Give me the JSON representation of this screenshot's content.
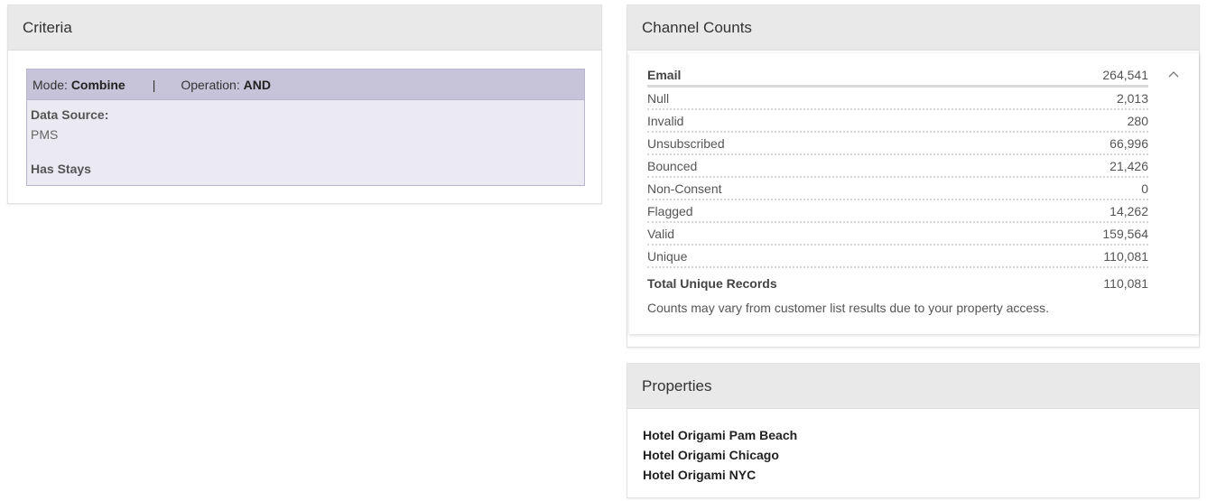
{
  "criteria": {
    "title": "Criteria",
    "mode_label": "Mode:",
    "mode_value": "Combine",
    "separator": "|",
    "operation_label": "Operation:",
    "operation_value": "AND",
    "data_source_label": "Data Source:",
    "data_source_value": "PMS",
    "has_stays": "Has Stays"
  },
  "channel_counts": {
    "title": "Channel Counts",
    "header": {
      "label": "Email",
      "value": "264,541"
    },
    "rows": [
      {
        "label": "Null",
        "value": "2,013"
      },
      {
        "label": "Invalid",
        "value": "280"
      },
      {
        "label": "Unsubscribed",
        "value": "66,996"
      },
      {
        "label": "Bounced",
        "value": "21,426"
      },
      {
        "label": "Non-Consent",
        "value": "0"
      },
      {
        "label": "Flagged",
        "value": "14,262"
      },
      {
        "label": "Valid",
        "value": "159,564"
      },
      {
        "label": "Unique",
        "value": "110,081"
      }
    ],
    "total": {
      "label": "Total Unique Records",
      "value": "110,081"
    },
    "note": "Counts may vary from customer list results due to your property access.",
    "collapse_icon": "chevron-up-icon"
  },
  "properties": {
    "title": "Properties",
    "items": [
      "Hotel Origami Pam Beach",
      "Hotel Origami Chicago",
      "Hotel Origami NYC"
    ]
  }
}
